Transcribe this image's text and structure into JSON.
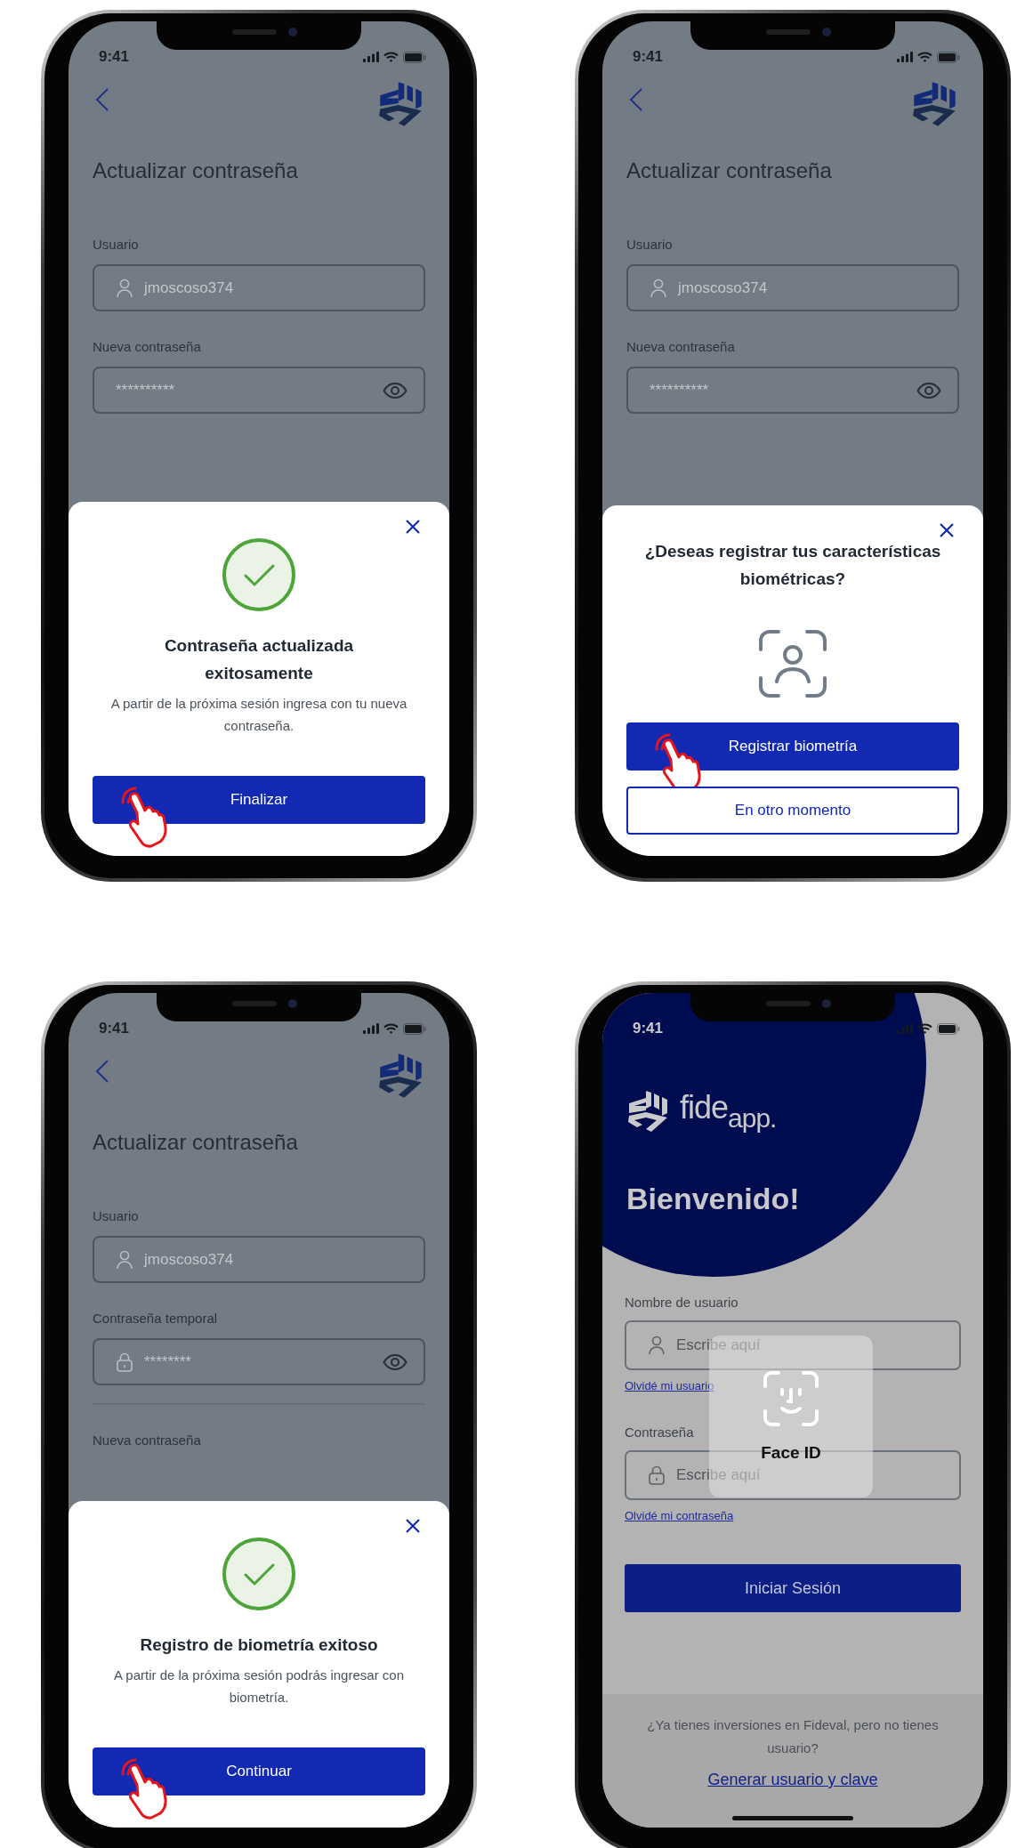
{
  "phones": [
    {
      "kind": "update",
      "status": {
        "time": "9:41"
      },
      "title": "Actualizar contraseña",
      "fields": [
        {
          "label": "Usuario",
          "kind": "user",
          "value": "jmoscoso374"
        },
        {
          "label": "Nueva contraseña",
          "kind": "plain",
          "value": "**********",
          "reveal": true
        }
      ],
      "sheet": {
        "kind": "success",
        "title": "Contraseña actualizada exitosamente",
        "message": "A partir de la próxima sesión ingresa con tu nueva contraseña.",
        "buttons": [
          {
            "label": "Finalizar",
            "kind": "primary",
            "tapped": true
          }
        ]
      }
    },
    {
      "kind": "update",
      "status": {
        "time": "9:41"
      },
      "title": "Actualizar contraseña",
      "fields": [
        {
          "label": "Usuario",
          "kind": "user",
          "value": "jmoscoso374"
        },
        {
          "label": "Nueva contraseña",
          "kind": "plain",
          "value": "**********",
          "reveal": true
        }
      ],
      "sheet": {
        "kind": "biometric",
        "title": "¿Deseas registrar tus características biométricas?",
        "buttons": [
          {
            "label": "Registrar biometría",
            "kind": "primary",
            "tapped": true
          },
          {
            "label": "En otro momento",
            "kind": "outline",
            "tapped": false
          }
        ]
      }
    },
    {
      "kind": "update",
      "status": {
        "time": "9:41"
      },
      "title": "Actualizar contraseña",
      "fields": [
        {
          "label": "Usuario",
          "kind": "user",
          "value": "jmoscoso374"
        },
        {
          "label": "Contraseña temporal",
          "kind": "lock",
          "value": "********",
          "reveal": true,
          "divider": true
        },
        {
          "label": "Nueva contraseña"
        }
      ],
      "sheet": {
        "kind": "success",
        "title": "Registro de biometría exitoso",
        "message": "A partir de la próxima sesión podrás ingresar con biometría.",
        "buttons": [
          {
            "label": "Continuar",
            "kind": "primary",
            "tapped": true
          }
        ]
      }
    },
    {
      "kind": "login",
      "status": {
        "time": "9:41"
      },
      "brand": "fide$_{app.}$",
      "heading": "Bienvenido!",
      "fields": [
        {
          "label": "Nombre de usuario",
          "kind": "user",
          "placeholder": "Escribe aquí",
          "link": "Olvidé mi usuario"
        },
        {
          "label": "Contraseña",
          "kind": "lock",
          "placeholder": "Escribe aquí",
          "link": "Olvidé mi contraseña"
        }
      ],
      "button": "Iniciar Sesión",
      "footer": {
        "text": "¿Ya tienes inversiones en Fideval, pero no tienes usuario?",
        "link": "Generar usuario y clave"
      },
      "face_id": {
        "label": "Face ID"
      }
    }
  ]
}
